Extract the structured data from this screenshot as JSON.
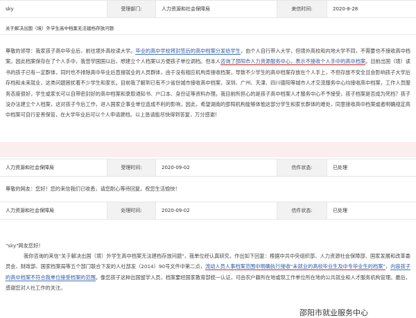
{
  "top_row": {
    "user": "sky",
    "dept_label": "受理部门:",
    "dept_value": "人力资源和社会保障局",
    "date_label": "来信时间:",
    "date_value": "2020-8-28"
  },
  "subject": "关于解决出国（境）外学生高中档案无法建档存放问题",
  "letter": {
    "p1_a": "尊敬的领导：我家孩子高中毕业后，前往境外高校读大学。",
    "p1_u1": "毕业的高中学校将封签后的高中档案分发给学生",
    "p1_b": "，由个人自行带入大学，但境外高校和内地大学不同，不需要也不接收高中档案。因此档案保存在了个人手中，我曾学国国以后，想建立个人档案以方便孩子单位调档。但本人",
    "p1_u2": "咨询了邵阳市人力资源服务中心，表示不接收个人手中的高中档案",
    "p1_c": "。目前出国（境）读书的孩子已有一定群体，同时也不排除高中毕业后直接就业的人员群体，由于没有相应机构肯接收档案，导致不少学生的高中档案存放在个人手上，不但存放不安全且会影响孩子大学后存档和未来就业，这类问题困扰着不少学生和家长。目前我了解到已有不少省份城市接收高中档案，深圳、广州、天津、四川德阳等城市人才交流服务中心均接收高中档案，工作人员服务态度很好，学生或家长可以自带密封好的高中档案和录取通知书、户口本、身份证等资料办理。我目前所担心的是孩子高中档案人才服务中心不予接受，孩子档案是否成为死档？孩子没办法建立个人档案，这对孩子今后工作，进入国家企事业单位造成不利的影响，因此，希望湖南的邵阳机构能够体恤这部分学生和家长群体的难处，同意接收高中档案或者明确规定高中档案可自行妥善保管，在大学毕业后可以个人申请建档。以上恳请能尽快得到答复，万分感谢！"
  },
  "reply_row": {
    "dept": "人力资源和社会保障局",
    "time_label": "受理时间:",
    "time_value": "2020-09-02",
    "status_label": "信件状态:",
    "status_value": "已处理"
  },
  "reply_short": "尊敬的网友：您好！您的来信我们已收悉，请您耐心等待回复。祝您生活愉快！",
  "process_row": {
    "dept": "人力资源和社会保障局",
    "time_label": "处理时间:",
    "time_value": "2020-09-02",
    "status_label": "信件状态:",
    "status_value": "已处理"
  },
  "reply_full": {
    "greeting": "\"sky\"网友您好！",
    "a": "我你咨询的来信\"关于解决出国（境）外学生高中档案无法建档存放问题\"，我单位经认真研究，作出如下回复：根据中共中央组织部、人力资源社会保障部、国家发展和改革委员会、财政部、国家档案局等五个部门联合下发的人社部发（2014）90号文件中第二点，",
    "u1": "流动人员人事档案范围中明确执行接收\"未就业的高校毕业生及中专毕业生的档案\"",
    "b": "，",
    "u2": "内容孩子的高中档案不符合我单位接受档案的范围",
    "c": "。像您孩子这种出国留学人员，档案要经国家教育部统一认证，可由农户籍所在地或现工作单位所在地的公共就业和人才服务机构管理。最后，感谢您对人社工作的关注。"
  },
  "signature": "邵阳市就业服务中心"
}
